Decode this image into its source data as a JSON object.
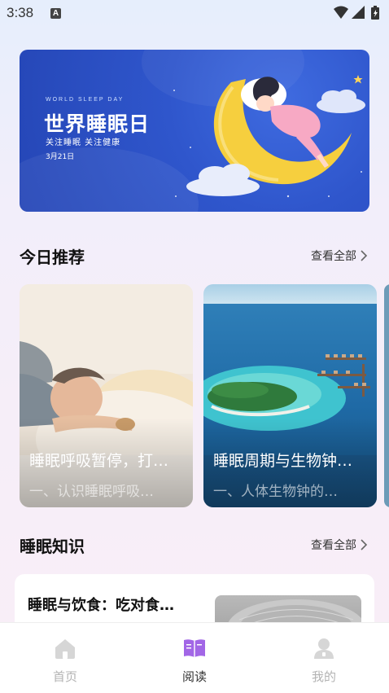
{
  "status_bar": {
    "time": "3:38",
    "notification_badge": "A"
  },
  "banner": {
    "subtitle_en": "WORLD SLEEP DAY",
    "title": "世界睡眠日",
    "tagline": "关注睡眠 关注健康",
    "date": "3月21日"
  },
  "today_section": {
    "title": "今日推荐",
    "more_label": "查看全部",
    "cards": [
      {
        "title": "睡眠呼吸暂停，打…",
        "subtitle": "一、认识睡眠呼吸…"
      },
      {
        "title": "睡眠周期与生物钟…",
        "subtitle": "一、人体生物钟的…"
      }
    ]
  },
  "knowledge_section": {
    "title": "睡眠知识",
    "more_label": "查看全部",
    "items": [
      {
        "title": "睡眠与饮食：吃对食…"
      }
    ]
  },
  "bottom_nav": {
    "items": [
      {
        "label": "首页",
        "icon": "home-icon",
        "active": false
      },
      {
        "label": "阅读",
        "icon": "book-icon",
        "active": true
      },
      {
        "label": "我的",
        "icon": "user-icon",
        "active": false
      }
    ]
  },
  "colors": {
    "accent": "#a266e6",
    "banner_blue": "#2f56cc",
    "inactive_nav": "#b3b3b3"
  }
}
